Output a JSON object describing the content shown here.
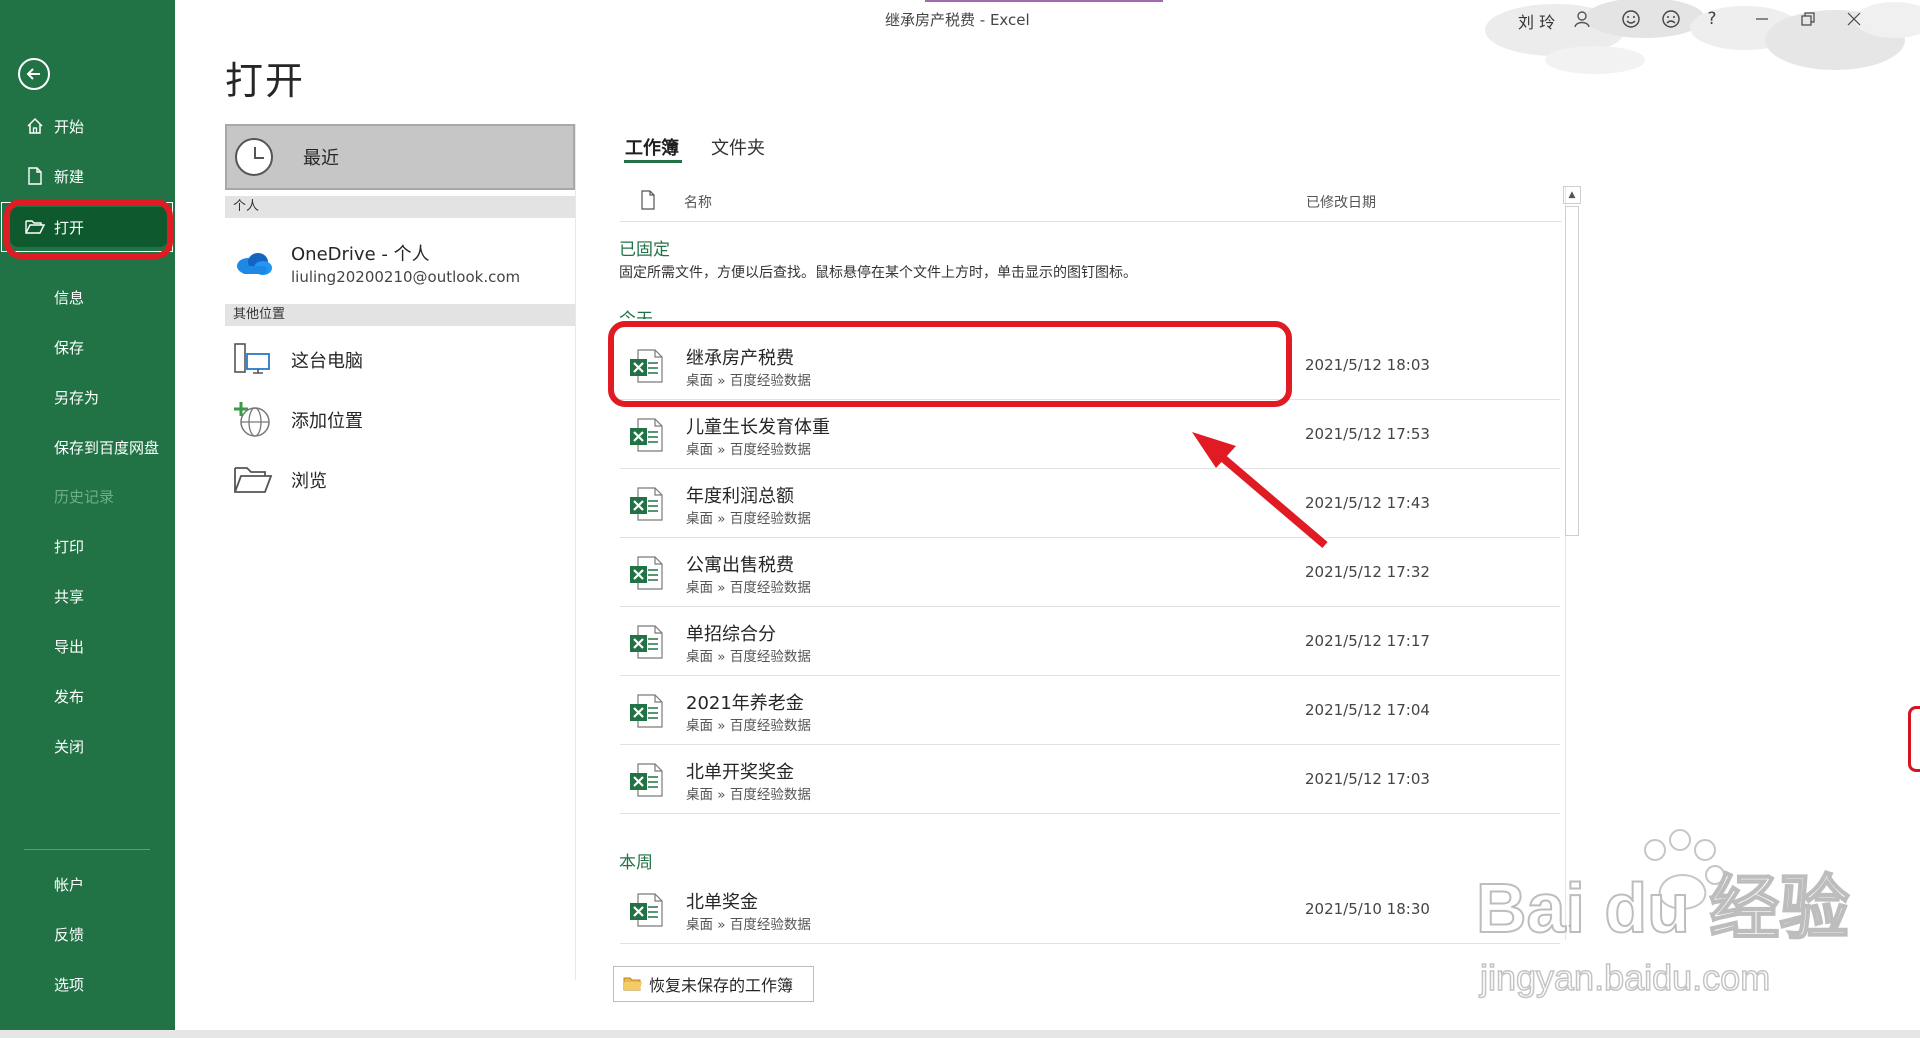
{
  "window": {
    "title": "继承房产税费 - Excel",
    "user": "刘 玲"
  },
  "sidebar": {
    "items": [
      {
        "label": "开始",
        "icon": "home-icon"
      },
      {
        "label": "新建",
        "icon": "new-document-icon"
      },
      {
        "label": "打开",
        "icon": "open-folder-icon",
        "active": true
      },
      {
        "label": "信息"
      },
      {
        "label": "保存"
      },
      {
        "label": "另存为"
      },
      {
        "label": "保存到百度网盘"
      },
      {
        "label": "历史记录",
        "disabled": true
      },
      {
        "label": "打印"
      },
      {
        "label": "共享"
      },
      {
        "label": "导出"
      },
      {
        "label": "发布"
      },
      {
        "label": "关闭"
      }
    ],
    "bottom_items": [
      {
        "label": "帐户"
      },
      {
        "label": "反馈"
      },
      {
        "label": "选项"
      }
    ]
  },
  "page": {
    "title": "打开"
  },
  "locations": {
    "recent": "最近",
    "personal_section": "个人",
    "onedrive_title": "OneDrive - 个人",
    "onedrive_account": "liuling20200210@outlook.com",
    "other_section": "其他位置",
    "this_pc": "这台电脑",
    "add_place": "添加位置",
    "browse": "浏览"
  },
  "tabs": {
    "workbooks": "工作簿",
    "folders": "文件夹"
  },
  "list_header": {
    "name": "名称",
    "modified": "已修改日期"
  },
  "groups": {
    "pinned": "已固定",
    "pinned_desc": "固定所需文件，方便以后查找。鼠标悬停在某个文件上方时，单击显示的图钉图标。",
    "today": "今天",
    "this_week": "本周"
  },
  "files_today": [
    {
      "name": "继承房产税费",
      "path": "桌面 » 百度经验数据",
      "date": "2021/5/12 18:03"
    },
    {
      "name": "儿童生长发育体重",
      "path": "桌面 » 百度经验数据",
      "date": "2021/5/12 17:53"
    },
    {
      "name": "年度利润总额",
      "path": "桌面 » 百度经验数据",
      "date": "2021/5/12 17:43"
    },
    {
      "name": "公寓出售税费",
      "path": "桌面 » 百度经验数据",
      "date": "2021/5/12 17:32"
    },
    {
      "name": "单招综合分",
      "path": "桌面 » 百度经验数据",
      "date": "2021/5/12 17:17"
    },
    {
      "name": "2021年养老金",
      "path": "桌面 » 百度经验数据",
      "date": "2021/5/12 17:04"
    },
    {
      "name": "北单开奖奖金",
      "path": "桌面 » 百度经验数据",
      "date": "2021/5/12 17:03"
    }
  ],
  "files_week": [
    {
      "name": "北单奖金",
      "path": "桌面 » 百度经验数据",
      "date": "2021/5/10 18:30"
    }
  ],
  "recover_button": "恢复未保存的工作簿",
  "watermark": {
    "brand": "Bai du 经验",
    "url": "jingyan.baidu.com"
  },
  "colors": {
    "accent": "#217346",
    "active_nav": "#0e5a2e",
    "annotation": "#e01b24"
  }
}
